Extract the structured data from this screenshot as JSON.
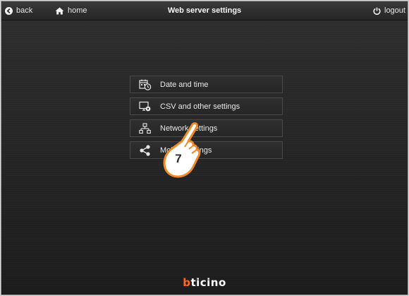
{
  "topbar": {
    "back_label": "back",
    "home_label": "home",
    "title": "Web server settings",
    "logout_label": "logout"
  },
  "menu": {
    "items": [
      {
        "label": "Date and time",
        "icon": "calendar-clock-icon"
      },
      {
        "label": "CSV and other settings",
        "icon": "monitor-gear-icon"
      },
      {
        "label": "Network settings",
        "icon": "network-icon"
      },
      {
        "label": "Mobile settings",
        "icon": "share-icon"
      }
    ]
  },
  "callout": {
    "step_number": "7",
    "icon": "pointing-hand-icon",
    "color": "#f08a24"
  },
  "footer": {
    "brand_b": "b",
    "brand_rest": "ticino",
    "brand_accent": "#ff6a1a"
  }
}
